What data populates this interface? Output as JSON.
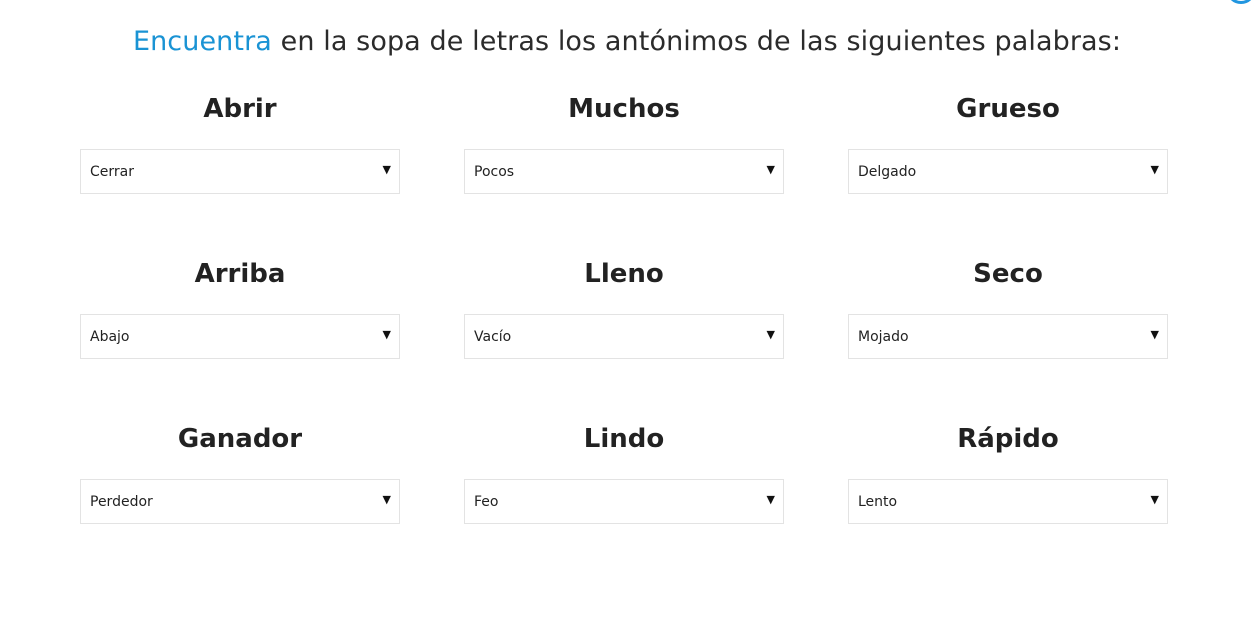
{
  "instruction": {
    "highlight": "Encuentra",
    "rest": " en la sopa de letras los antónimos de las siguientes palabras:"
  },
  "colors": {
    "accent": "#1a93d4",
    "badge": "#2196e0"
  },
  "items": [
    {
      "word": "Abrir",
      "selected": "Cerrar"
    },
    {
      "word": "Muchos",
      "selected": "Pocos"
    },
    {
      "word": "Grueso",
      "selected": "Delgado"
    },
    {
      "word": "Arriba",
      "selected": "Abajo"
    },
    {
      "word": "Lleno",
      "selected": "Vacío"
    },
    {
      "word": "Seco",
      "selected": "Mojado"
    },
    {
      "word": "Ganador",
      "selected": "Perdedor"
    },
    {
      "word": "Lindo",
      "selected": "Feo"
    },
    {
      "word": "Rápido",
      "selected": "Lento"
    }
  ],
  "dropdown_icon": "caret-down-icon"
}
